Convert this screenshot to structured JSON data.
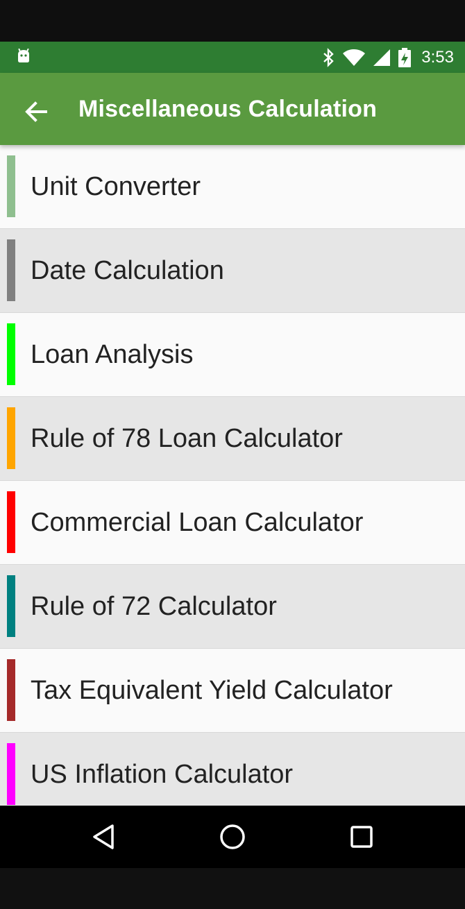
{
  "status_bar": {
    "time": "3:53",
    "icons": [
      "android-icon",
      "bluetooth-icon",
      "wifi-icon",
      "signal-icon",
      "battery-icon"
    ]
  },
  "app_bar": {
    "title": "Miscellaneous Calculation",
    "back_icon": "arrow-left-icon",
    "background": "#5a9a40"
  },
  "list": {
    "items": [
      {
        "label": "Unit Converter",
        "color": "#8fbf8f"
      },
      {
        "label": "Date Calculation",
        "color": "#808080"
      },
      {
        "label": "Loan Analysis",
        "color": "#00ff00"
      },
      {
        "label": "Rule of 78 Loan Calculator",
        "color": "#ffa500"
      },
      {
        "label": "Commercial Loan Calculator",
        "color": "#ff0000"
      },
      {
        "label": "Rule of 72 Calculator",
        "color": "#008080"
      },
      {
        "label": "Tax Equivalent Yield Calculator",
        "color": "#a52a2a"
      },
      {
        "label": "US Inflation Calculator",
        "color": "#ff00ff"
      }
    ]
  },
  "nav_bar": {
    "icons": [
      "back-triangle-icon",
      "home-circle-icon",
      "recents-square-icon"
    ]
  }
}
